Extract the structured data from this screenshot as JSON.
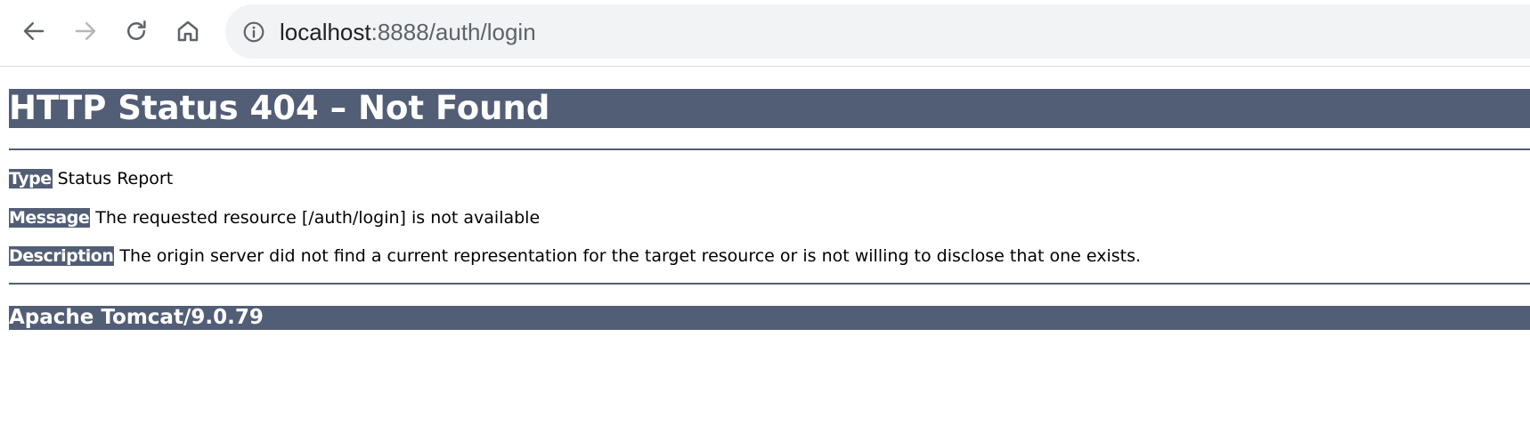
{
  "browser": {
    "url_host": "localhost",
    "url_rest": ":8888/auth/login",
    "icons": {
      "back": "arrow-left",
      "forward": "arrow-right",
      "reload": "reload",
      "home": "home",
      "site_info": "info-circle"
    },
    "forward_enabled": false
  },
  "error_page": {
    "title": "HTTP Status 404 – Not Found",
    "fields": {
      "type_label": "Type",
      "type_value": " Status Report",
      "message_label": "Message",
      "message_value": " The requested resource [/auth/login] is not available",
      "description_label": "Description",
      "description_value": " The origin server did not find a current representation for the target resource or is not willing to disclose that one exists."
    },
    "server_version": "Apache Tomcat/9.0.79"
  },
  "colors": {
    "tomcat_banner": "#525d76",
    "banner_text": "#ffffff",
    "omnibox_bg": "#f1f3f4",
    "icon_active": "#5f6368",
    "icon_disabled": "#b4b6b9"
  }
}
